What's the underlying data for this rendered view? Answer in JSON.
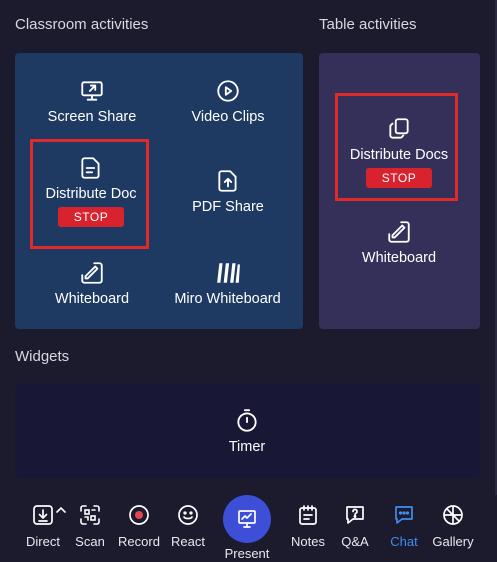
{
  "classroom": {
    "title": "Classroom activities",
    "screen_share": "Screen Share",
    "video_clips": "Video Clips",
    "distribute_doc": "Distribute Doc",
    "distribute_doc_stop": "STOP",
    "pdf_share": "PDF Share",
    "whiteboard": "Whiteboard",
    "miro_whiteboard": "Miro Whiteboard"
  },
  "table": {
    "title": "Table activities",
    "distribute_docs": "Distribute Docs",
    "distribute_docs_stop": "STOP",
    "whiteboard": "Whiteboard"
  },
  "widgets": {
    "title": "Widgets",
    "timer": "Timer"
  },
  "toolbar": {
    "direct": "Direct",
    "scan": "Scan",
    "record": "Record",
    "react": "React",
    "present": "Present",
    "notes": "Notes",
    "qa": "Q&A",
    "chat": "Chat",
    "gallery": "Gallery",
    "active": "Chat"
  },
  "colors": {
    "accent": "#3d8ef0",
    "stop": "#d8232f",
    "highlight": "#e02a2a",
    "classroom_bg": "#1e3a63",
    "table_bg": "#35305a",
    "widget_bg": "#181735",
    "present_bg": "#3d4fd6"
  }
}
